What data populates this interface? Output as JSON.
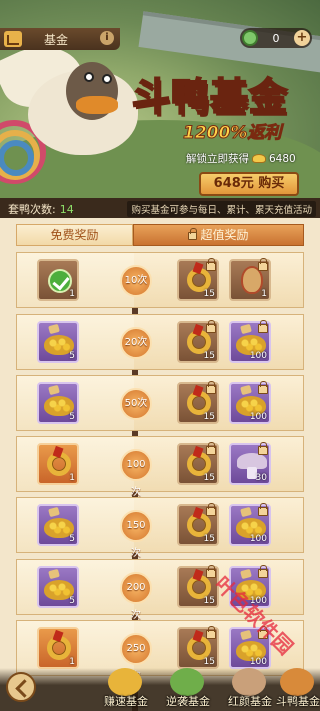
{
  "topbar": {
    "tab_label": "基金",
    "info_icon": "i",
    "currency_value": "0",
    "plus": "+"
  },
  "banner": {
    "title": "斗鸭基金",
    "percent": "1200%返利",
    "unlock_label": "解锁立即获得",
    "unlock_value": "6480",
    "buy_label": "648元 购买"
  },
  "count": {
    "label": "套鸭次数:",
    "value": "14",
    "tip": "购买基金可参与每日、累计、累天充值活动"
  },
  "list": {
    "free_header": "免费奖励",
    "premium_header": "超值奖励",
    "rows": [
      {
        "level": "10次",
        "free": {
          "type": "check",
          "quality": "brown",
          "count": "1"
        },
        "p1": {
          "type": "ring",
          "quality": "brown",
          "count": "15"
        },
        "p2": {
          "type": "egg",
          "quality": "brown",
          "count": "1"
        }
      },
      {
        "level": "20次",
        "free": {
          "type": "beans",
          "quality": "purple",
          "count": "5"
        },
        "p1": {
          "type": "ring",
          "quality": "brown",
          "count": "15"
        },
        "p2": {
          "type": "beans",
          "quality": "purple",
          "count": "100"
        }
      },
      {
        "level": "50次",
        "free": {
          "type": "beans",
          "quality": "purple",
          "count": "5"
        },
        "p1": {
          "type": "ring",
          "quality": "brown",
          "count": "15"
        },
        "p2": {
          "type": "beans",
          "quality": "purple",
          "count": "100"
        }
      },
      {
        "level": "100次",
        "free": {
          "type": "ring",
          "quality": "orange",
          "count": "1"
        },
        "p1": {
          "type": "ring",
          "quality": "brown",
          "count": "15"
        },
        "p2": {
          "type": "mushroom",
          "quality": "purple",
          "count": "30"
        }
      },
      {
        "level": "150次",
        "free": {
          "type": "beans",
          "quality": "purple",
          "count": "5"
        },
        "p1": {
          "type": "ring",
          "quality": "brown",
          "count": "15"
        },
        "p2": {
          "type": "beans",
          "quality": "purple",
          "count": "100"
        }
      },
      {
        "level": "200次",
        "free": {
          "type": "beans",
          "quality": "purple",
          "count": "5"
        },
        "p1": {
          "type": "ring",
          "quality": "brown",
          "count": "15"
        },
        "p2": {
          "type": "beans",
          "quality": "purple",
          "count": "100"
        }
      },
      {
        "level": "250次",
        "free": {
          "type": "ring",
          "quality": "orange",
          "count": "1"
        },
        "p1": {
          "type": "ring",
          "quality": "brown",
          "count": "15"
        },
        "p2": {
          "type": "beans",
          "quality": "purple",
          "count": "100"
        }
      }
    ]
  },
  "bottom_tabs": [
    {
      "label": "赚速基金",
      "icon": "gold-ingot-icon",
      "color": "#e8b43a"
    },
    {
      "label": "逆袭基金",
      "icon": "duck-icon",
      "color": "#6fae4a"
    },
    {
      "label": "红颜基金",
      "icon": "lady-icon",
      "color": "#c9a07a"
    },
    {
      "label": "斗鸭基金",
      "icon": "fund-icon",
      "color": "#d88a3a"
    }
  ],
  "watermark": "叶色软件园",
  "colors": {
    "accent": "#d4772e",
    "track": "#5a3a26",
    "count_value": "#8fe06a"
  }
}
